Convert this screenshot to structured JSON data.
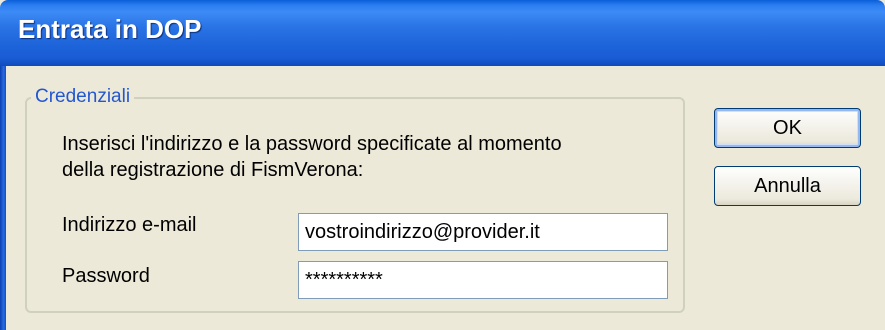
{
  "window": {
    "title": "Entrata in DOP"
  },
  "credentials": {
    "group_label": "Credenziali",
    "instructions_line1": "Inserisci l'indirizzo e la password specificate al momento",
    "instructions_line2": "della registrazione di FismVerona:",
    "email_label": "Indirizzo e-mail",
    "email_value": "vostroindirizzo@provider.it",
    "password_label": "Password",
    "password_value": "**********"
  },
  "buttons": {
    "ok_label": "OK",
    "cancel_label": "Annulla"
  },
  "colors": {
    "titlebar_accent": "#2a74e6",
    "legend_text": "#2357d1",
    "window_bg": "#ece9d8"
  }
}
